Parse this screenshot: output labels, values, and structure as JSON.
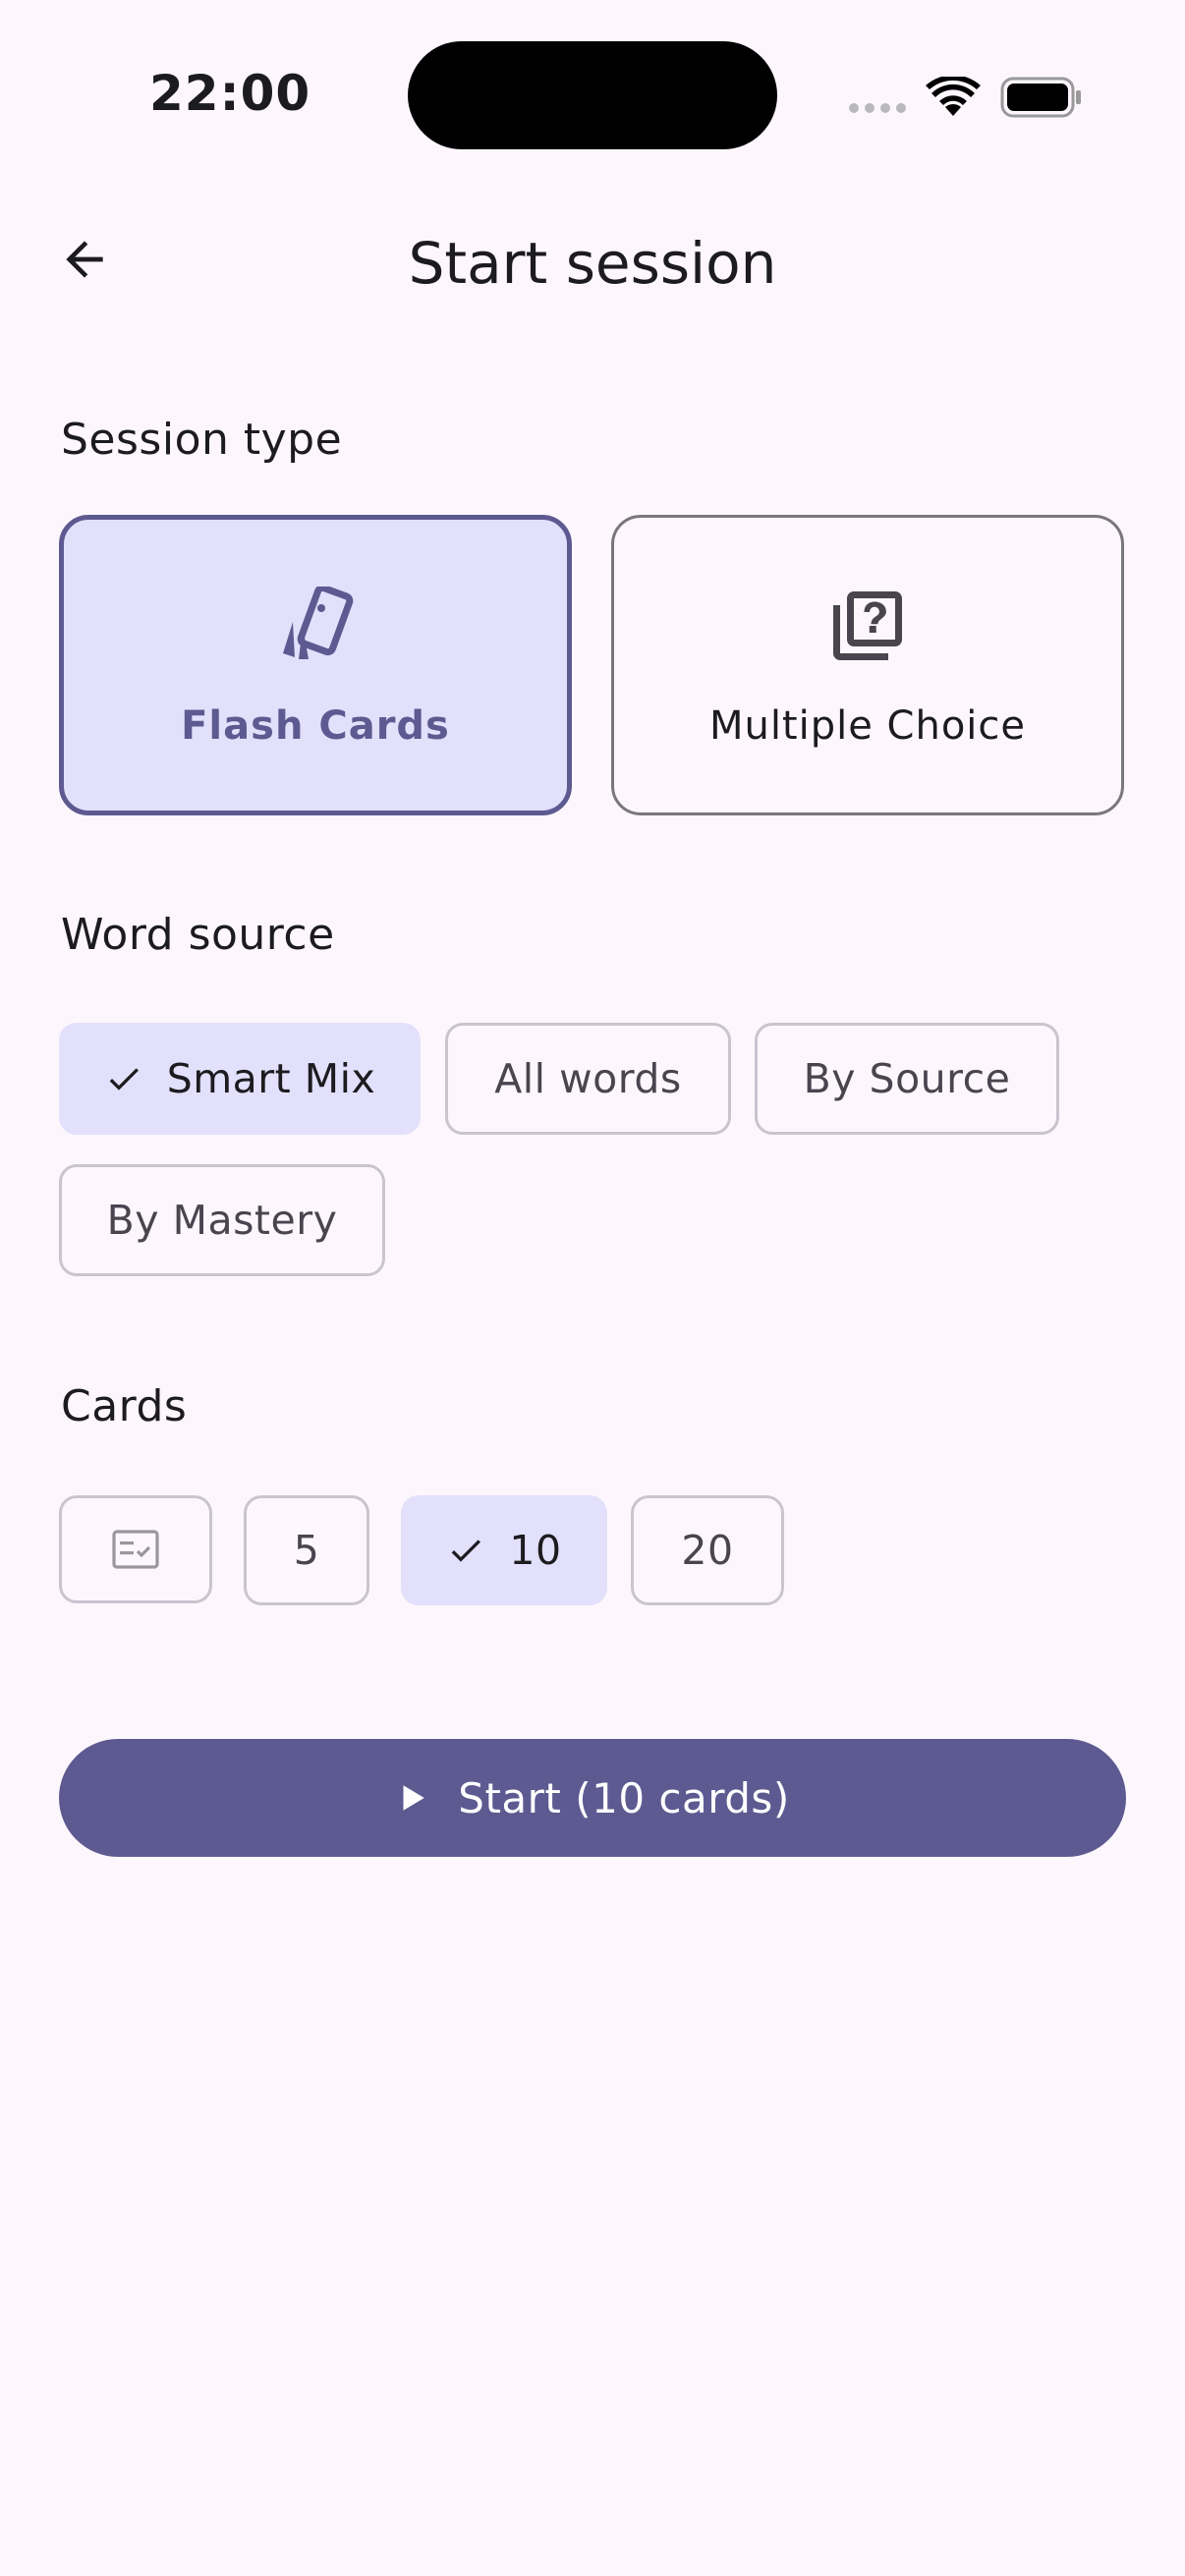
{
  "status_bar": {
    "time": "22:00"
  },
  "app_bar": {
    "title": "Start session",
    "back_icon": "arrow-back-icon"
  },
  "session_type": {
    "label": "Session type",
    "options": [
      {
        "label": "Flash Cards",
        "icon": "flash-cards-icon",
        "selected": true
      },
      {
        "label": "Multiple Choice",
        "icon": "quiz-icon",
        "selected": false
      }
    ]
  },
  "word_source": {
    "label": "Word source",
    "chips": [
      {
        "label": "Smart Mix",
        "selected": true
      },
      {
        "label": "All words",
        "selected": false
      },
      {
        "label": "By Source",
        "selected": false
      },
      {
        "label": "By Mastery",
        "selected": false
      }
    ]
  },
  "cards": {
    "label": "Cards",
    "custom_icon": "custom-count-icon",
    "chips": [
      {
        "label": "5",
        "selected": false
      },
      {
        "label": "10",
        "selected": true
      },
      {
        "label": "20",
        "selected": false
      }
    ]
  },
  "start_button": {
    "label": "Start (10 cards)",
    "icon": "play-icon"
  },
  "colors": {
    "primary": "#5d5a91",
    "selected_container": "#e2e0fb",
    "background": "#fdf7fd",
    "outline": "#cac4cf"
  }
}
